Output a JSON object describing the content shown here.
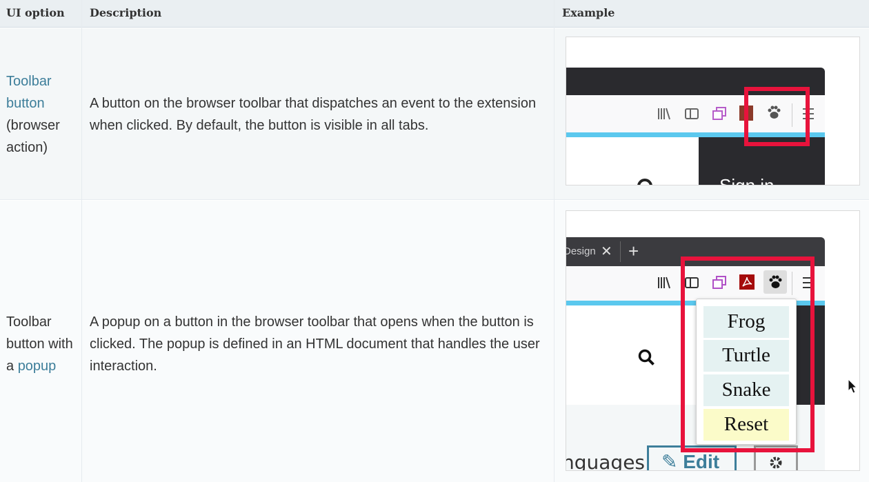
{
  "table": {
    "headers": [
      "UI option",
      "Description",
      "Example"
    ],
    "rows": [
      {
        "option_link": [
          "Toolbar",
          "button"
        ],
        "option_rest": [
          "(browser",
          "action)"
        ],
        "description": [
          "A button on the browser toolbar that dispatches an event to the extension",
          "when clicked. By default, the button is visible in all tabs."
        ],
        "example": {
          "signin": "Sign in"
        }
      },
      {
        "option_text": [
          "Toolbar",
          "button with",
          "a "
        ],
        "option_link": "popup",
        "description": [
          "A popup on a button in the browser toolbar that opens when the button is",
          "clicked. The popup is defined in an HTML document that handles the user",
          "interaction."
        ],
        "example": {
          "tab_label": "Design",
          "popup_items": [
            "Frog",
            "Turtle",
            "Snake",
            "Reset"
          ],
          "page_text": "nguages",
          "edit_label": "Edit"
        }
      }
    ]
  },
  "colors": {
    "link": "#3d7e9a",
    "highlight_box": "#e8133c",
    "header_bg": "#eaeff2",
    "toolbar_blue": "#5bc8ee"
  },
  "icons": [
    "library-icon",
    "sidebar-icon",
    "synced-tabs-icon",
    "pdf-icon",
    "paw-icon",
    "hamburger-menu-icon",
    "search-icon",
    "pencil-icon",
    "gear-icon",
    "close-icon",
    "plus-icon",
    "mouse-cursor-icon"
  ]
}
